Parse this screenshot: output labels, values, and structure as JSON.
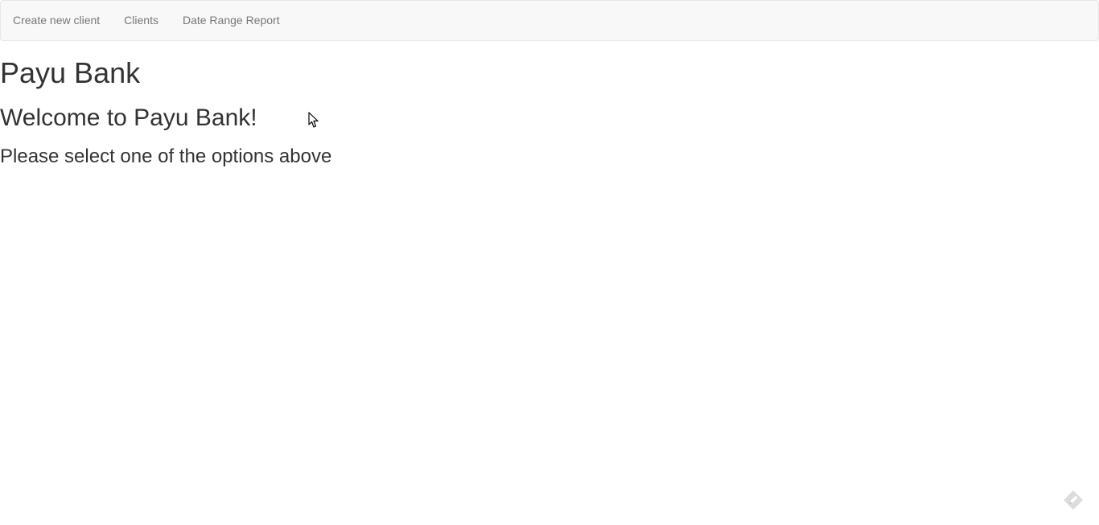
{
  "nav": {
    "items": [
      {
        "label": "Create new client"
      },
      {
        "label": "Clients"
      },
      {
        "label": "Date Range Report"
      }
    ]
  },
  "main": {
    "title": "Payu Bank",
    "welcome": "Welcome to Payu Bank!",
    "instruction": "Please select one of the options above"
  },
  "icons": {
    "cursor": "mouse-pointer-icon",
    "corner": "feedback-pencil-icon"
  },
  "colors": {
    "navbar_bg": "#f8f8f8",
    "navbar_border": "#e7e7e7",
    "nav_link": "#777777",
    "text": "#333333"
  }
}
